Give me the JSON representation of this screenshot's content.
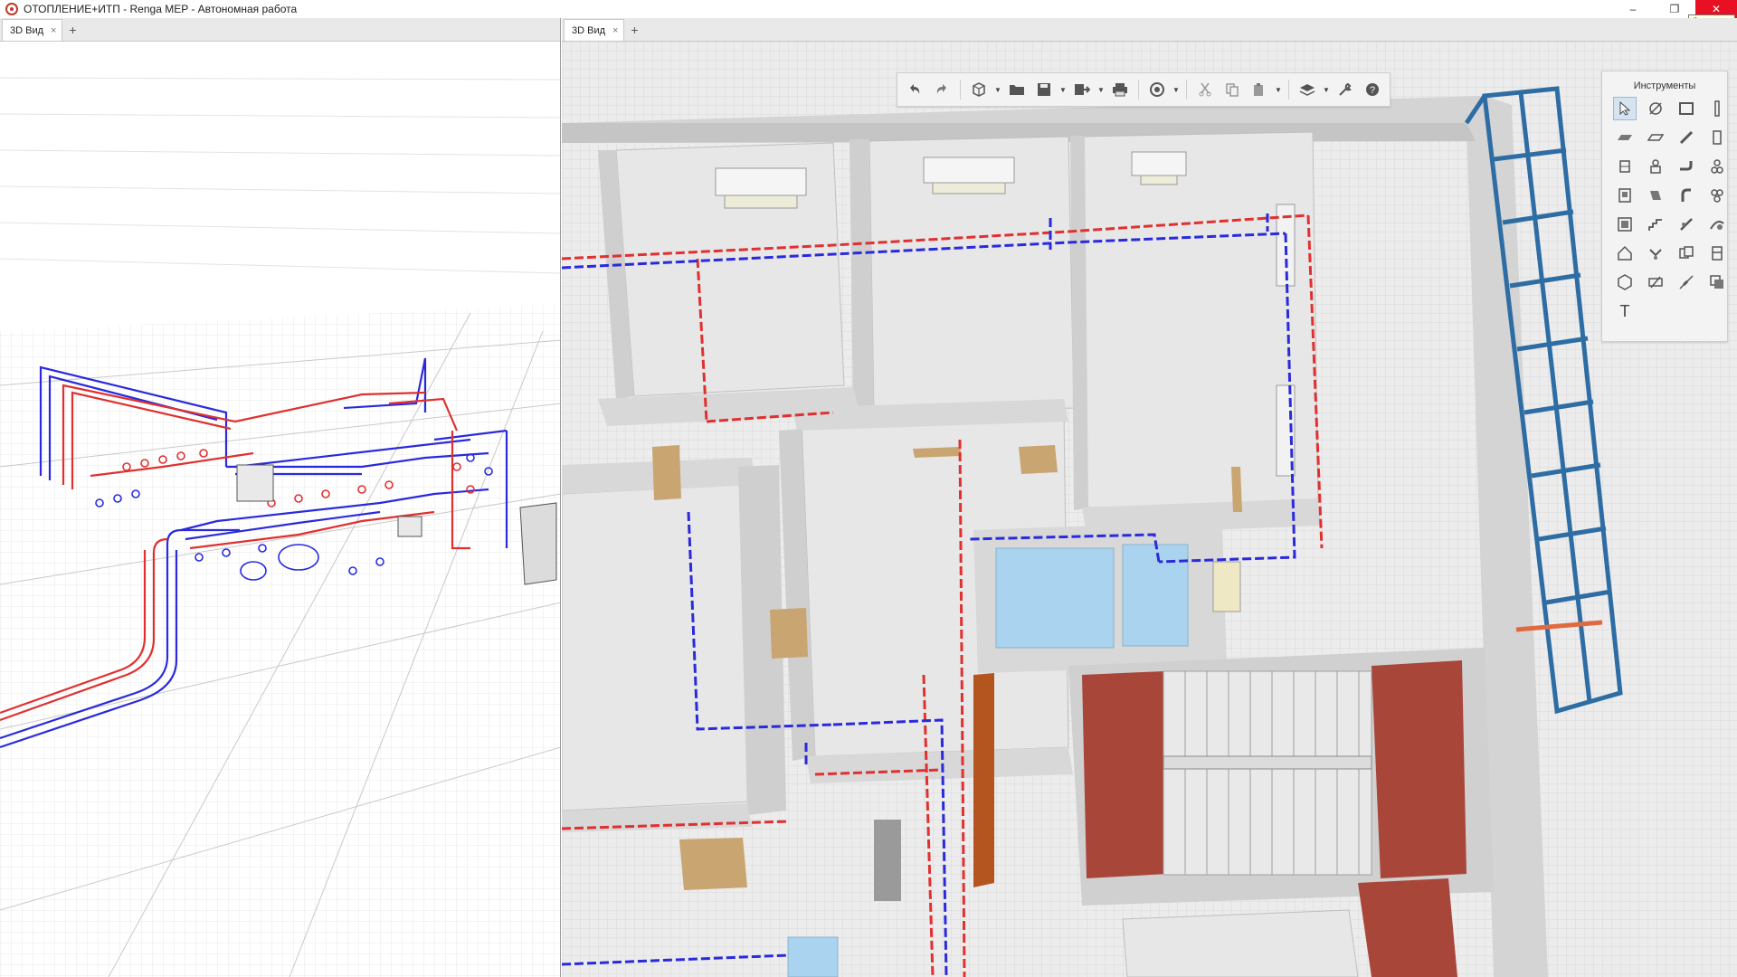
{
  "window": {
    "title": "ОТОПЛЕНИЕ+ИТП - Renga MEP - Автономная работа",
    "close_tooltip": "Закрыть",
    "minimize_glyph": "–",
    "restore_glyph": "❐",
    "close_glyph": "✕"
  },
  "left_pane": {
    "tab_label": "3D Вид",
    "tab_close": "×",
    "tab_add": "+"
  },
  "right_pane": {
    "tab_label": "3D Вид",
    "tab_close": "×",
    "tab_add": "+"
  },
  "toolbar": {
    "items": [
      "undo-icon",
      "redo-icon",
      "view-cube-icon",
      "open-folder-icon",
      "save-icon",
      "export-icon",
      "print-icon",
      "visibility-icon",
      "cut-icon",
      "copy-icon",
      "paste-icon",
      "layers-icon",
      "settings-wrench-icon",
      "help-icon"
    ]
  },
  "tools_panel": {
    "title": "Инструменты",
    "text_tool": "T",
    "tools": [
      "select-icon",
      "axis-icon",
      "wall-icon",
      "column-icon",
      "floor-icon",
      "slab-icon",
      "beam-icon",
      "door-icon",
      "window-icon",
      "equipment-icon",
      "pipe-fitting-icon",
      "accessory-icon",
      "panel-icon",
      "duct-icon",
      "pipe-icon",
      "mech-equipment-icon",
      "room-icon",
      "stair-icon",
      "ramp-icon",
      "route-icon",
      "roof-icon",
      "plumbing-icon",
      "opening-icon",
      "assembly-icon",
      "element-icon",
      "isolation-icon",
      "line-icon",
      "hatch-icon"
    ]
  },
  "colors": {
    "supply_pipe": "#e03030",
    "return_pipe": "#2a2adc",
    "wall": "#d9d9d9",
    "floor": "#e6e6e6",
    "glass": "#a9d3ee",
    "door": "#c9a572",
    "stair_floor": "#a9463a",
    "facade_frame": "#2e6da4",
    "selection_blue": "#d6e4f2"
  }
}
